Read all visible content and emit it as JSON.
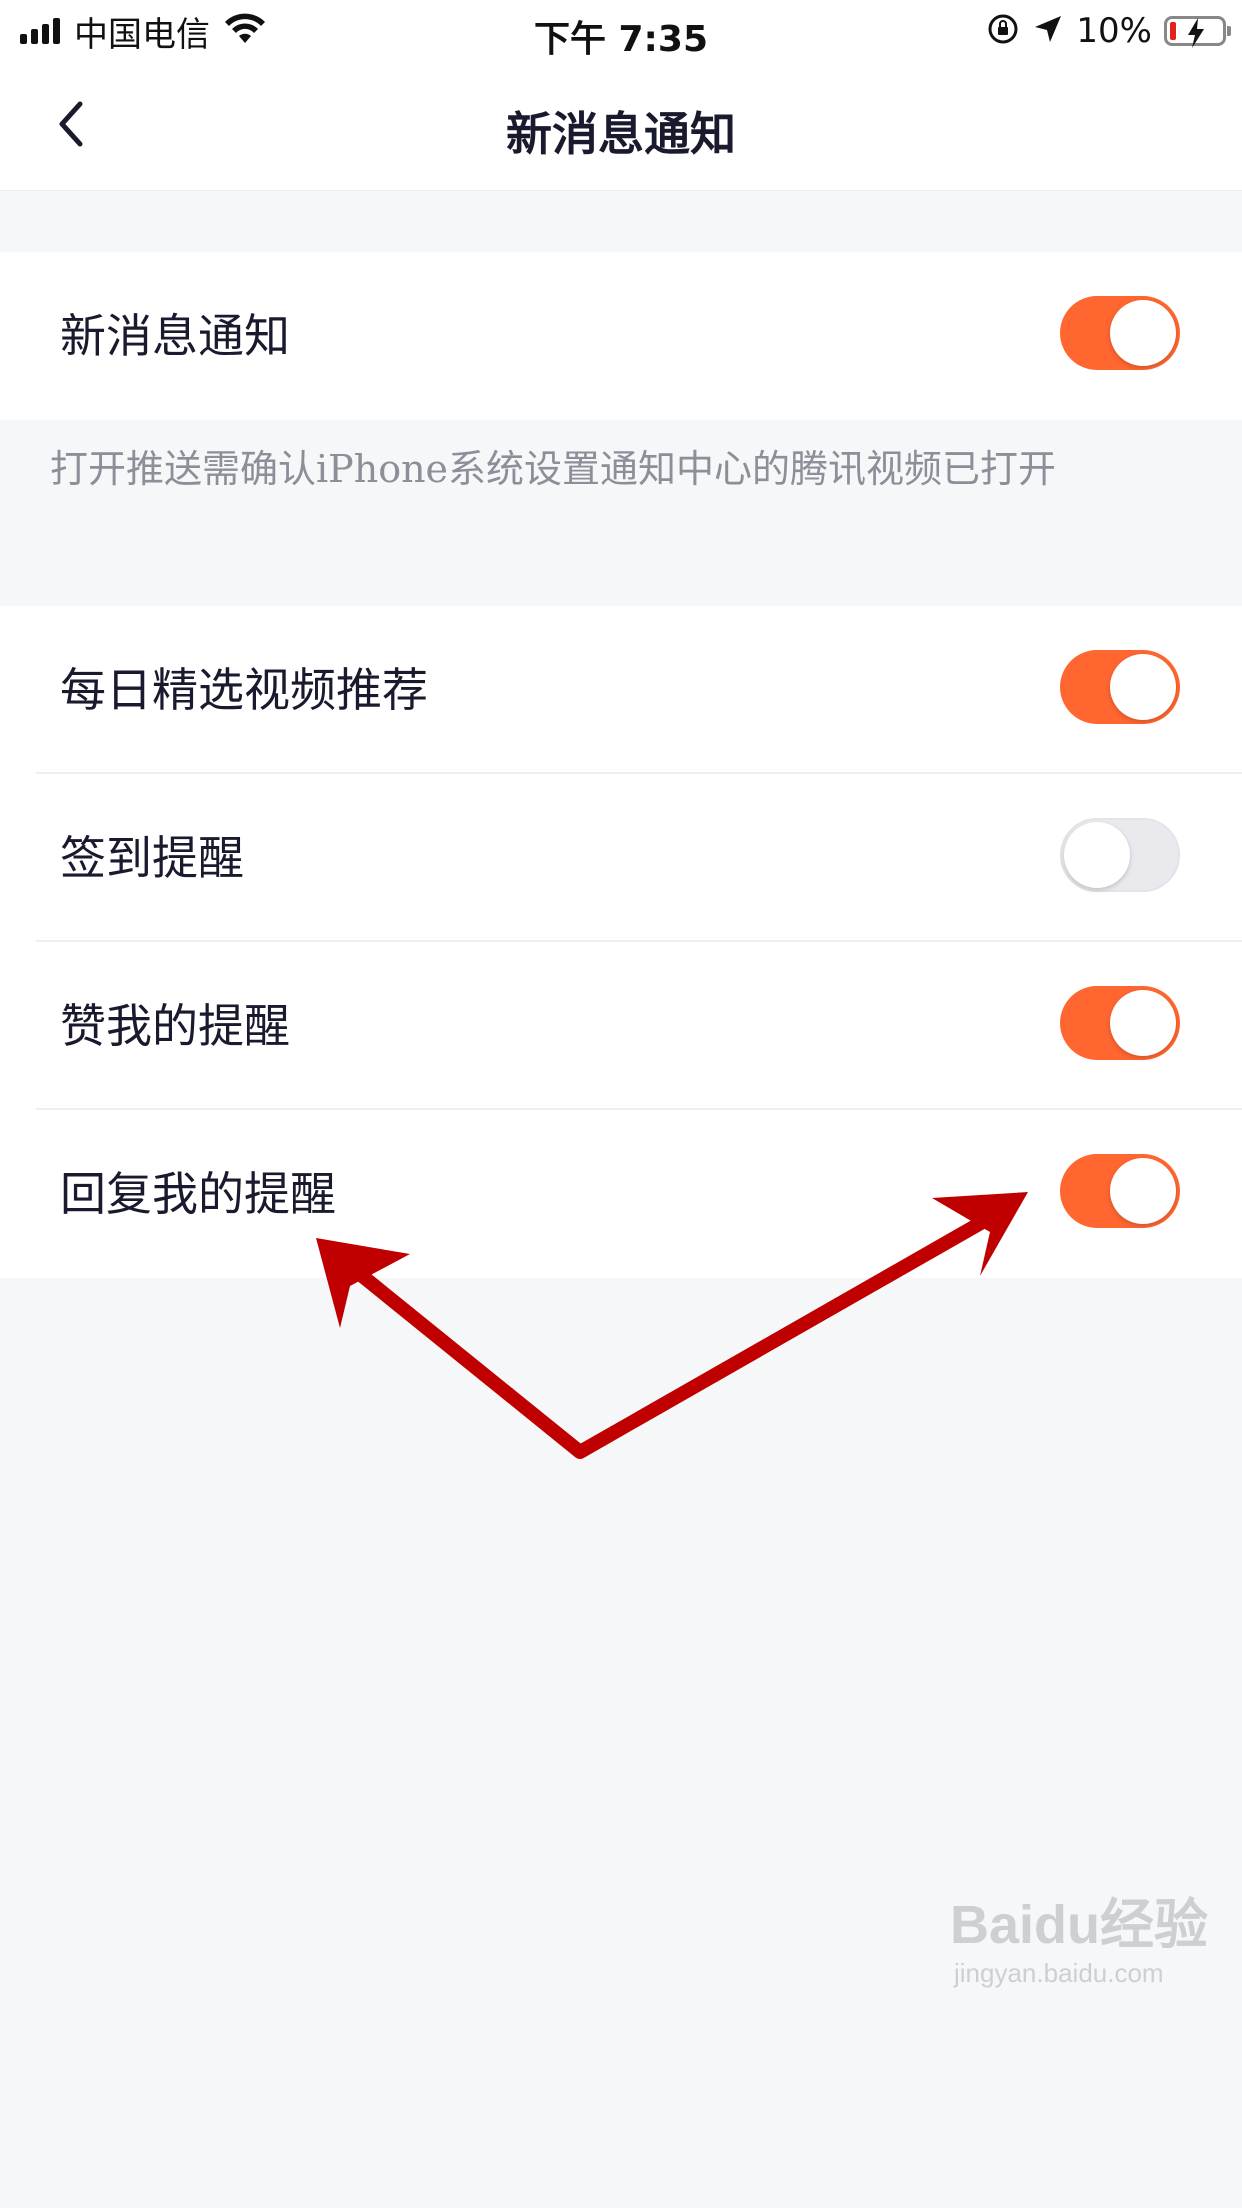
{
  "status_bar": {
    "carrier": "中国电信",
    "time": "下午 7:35",
    "battery_percent": "10%",
    "icons": [
      "signal-icon",
      "wifi-icon",
      "orientation-lock-icon",
      "location-icon",
      "battery-charging-icon"
    ]
  },
  "nav": {
    "back_icon": "chevron-left-icon",
    "title": "新消息通知"
  },
  "main_toggle": {
    "label": "新消息通知",
    "on": true
  },
  "hint": "打开推送需确认iPhone系统设置通知中心的腾讯视频已打开",
  "settings": [
    {
      "label": "每日精选视频推荐",
      "on": true
    },
    {
      "label": "签到提醒",
      "on": false
    },
    {
      "label": "赞我的提醒",
      "on": true
    },
    {
      "label": "回复我的提醒",
      "on": true
    }
  ],
  "colors": {
    "accent": "#ff6630",
    "background": "#f6f7f9",
    "annotation_arrow": "#c00000"
  },
  "watermark": {
    "brand": "Baidu经验",
    "url": "jingyan.baidu.com"
  }
}
